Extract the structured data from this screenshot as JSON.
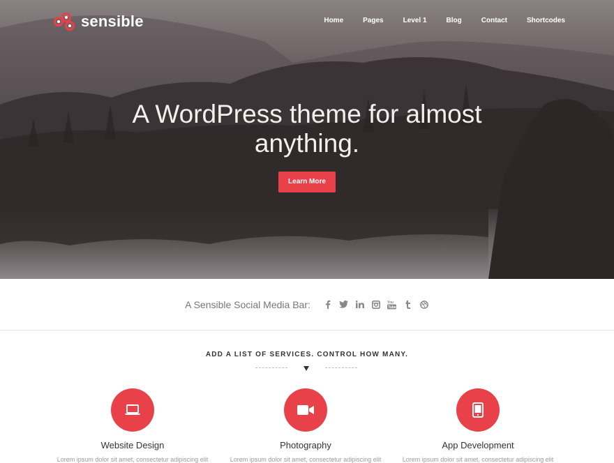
{
  "brand": {
    "name": "sensible",
    "accent_color": "#e8414a"
  },
  "nav": {
    "items": [
      {
        "label": "Home"
      },
      {
        "label": "Pages"
      },
      {
        "label": "Level 1"
      },
      {
        "label": "Blog"
      },
      {
        "label": "Contact"
      },
      {
        "label": "Shortcodes"
      }
    ]
  },
  "hero": {
    "title_line1": "A WordPress theme for almost",
    "title_line2": "anything.",
    "cta_label": "Learn More"
  },
  "social": {
    "label": "A Sensible Social Media Bar:",
    "icons": [
      "facebook-icon",
      "twitter-icon",
      "linkedin-icon",
      "instagram-icon",
      "youtube-icon",
      "tumblr-icon",
      "dribbble-icon"
    ]
  },
  "services": {
    "title": "ADD A LIST OF SERVICES. CONTROL HOW MANY.",
    "items": [
      {
        "name": "Website Design",
        "icon": "laptop-icon",
        "text": "Lorem ipsum dolor sit amet, consectetur adipiscing elit"
      },
      {
        "name": "Photography",
        "icon": "video-camera-icon",
        "text": "Lorem ipsum dolor sit amet, consectetur adipiscing elit"
      },
      {
        "name": "App Development",
        "icon": "tablet-icon",
        "text": "Lorem ipsum dolor sit amet, consectetur adipiscing elit"
      }
    ]
  }
}
